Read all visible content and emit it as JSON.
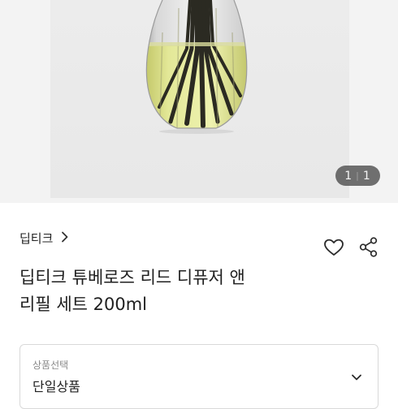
{
  "gallery": {
    "page_current": "1",
    "page_total": "1",
    "image": "product-photo-diffuser-bottle-with-reeds"
  },
  "product": {
    "brand": "딥티크",
    "title_line1": "딥티크 튜베로즈 리드 디퓨저 앤",
    "title_line2": "리필 세트 200ml"
  },
  "actions": {
    "like_icon": "heart-outline-icon",
    "share_icon": "share-icon"
  },
  "option": {
    "label": "상품선택",
    "value": "단일상품"
  },
  "colors": {
    "liquid": "#dfe58c",
    "reed": "#2b2a22",
    "badge": "#4a4a4a"
  }
}
